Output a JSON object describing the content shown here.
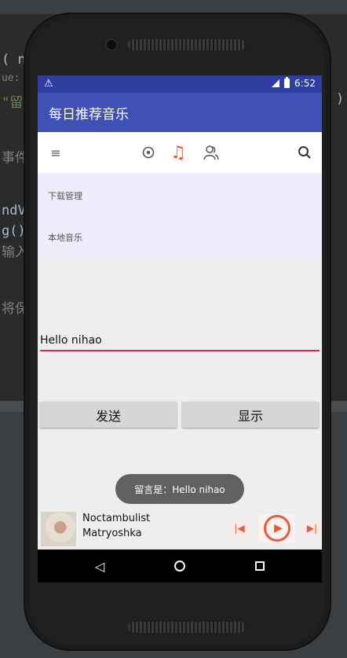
{
  "ide": {
    "frag_name": "( na",
    "frag_value": "ue: ",
    "frag_liu": "\"留",
    "frag_event": "事件",
    "frag_ndv": "ndV",
    "frag_g": "g()",
    "frag_input": "输入",
    "frag_save": "将保",
    "frag_paren": ")"
  },
  "status_bar": {
    "warning_icon": "warning-icon",
    "time": "6:52"
  },
  "app_bar": {
    "title": "每日推荐音乐"
  },
  "toolbar": {
    "icons": [
      "menu-icon",
      "disc-icon",
      "music-note-icon",
      "friends-icon",
      "search-icon"
    ],
    "active_color": "#f05a32"
  },
  "list": {
    "items": [
      {
        "label": "下载管理"
      },
      {
        "label": "本地音乐"
      }
    ]
  },
  "message": {
    "value": "Hello nihao",
    "underline_color": "#e91e63"
  },
  "buttons": {
    "send_label": "发送",
    "show_label": "显示"
  },
  "toast": {
    "text": "留言是：Hello nihao"
  },
  "player": {
    "title": "Noctambulist",
    "artist": "Matryoshka",
    "accent_color": "#e05a44"
  },
  "colors": {
    "status_bar": "#303f9f",
    "app_bar": "#3f51b5"
  }
}
